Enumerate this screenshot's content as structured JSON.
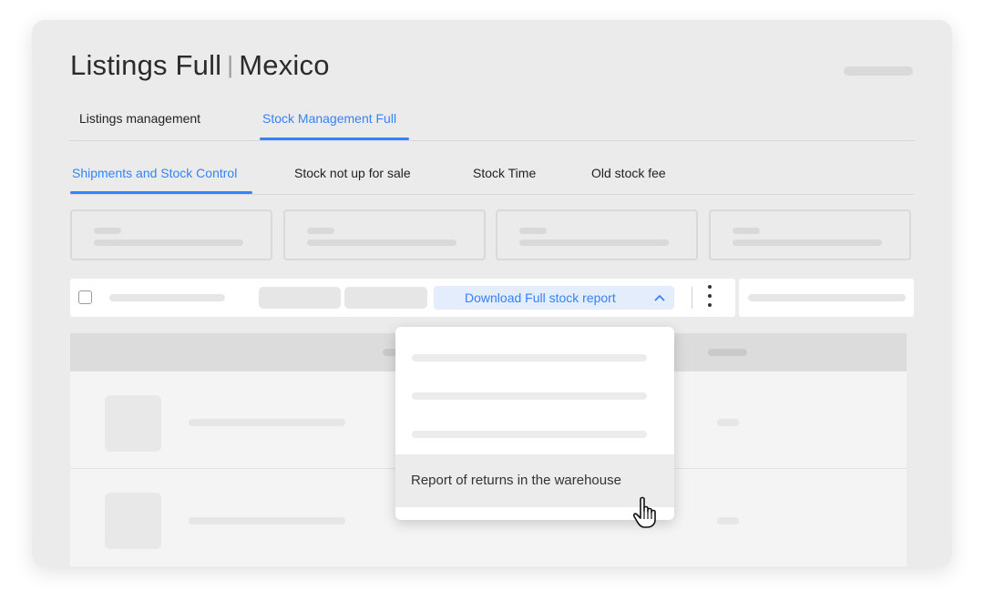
{
  "header": {
    "title_left": "Listings Full",
    "title_separator": "|",
    "title_right": "Mexico"
  },
  "main_tabs": [
    {
      "label": "Listings management",
      "active": false
    },
    {
      "label": "Stock Management Full",
      "active": true
    }
  ],
  "sub_tabs": [
    {
      "label": "Shipments and Stock Control",
      "active": true
    },
    {
      "label": "Stock not up for sale",
      "active": false
    },
    {
      "label": "Stock Time",
      "active": false
    },
    {
      "label": "Old stock fee",
      "active": false
    }
  ],
  "toolbar": {
    "download_button_label": "Download Full stock report",
    "download_button_icon": "chevron-up-icon",
    "more_icon": "kebab-menu-icon"
  },
  "dropdown": {
    "highlighted_item_label": "Report of returns in the warehouse"
  },
  "colors": {
    "accent": "#3483fa",
    "accent_bg": "#e3edfb",
    "card_bg": "#ebebeb",
    "placeholder": "#d9d9d9"
  }
}
